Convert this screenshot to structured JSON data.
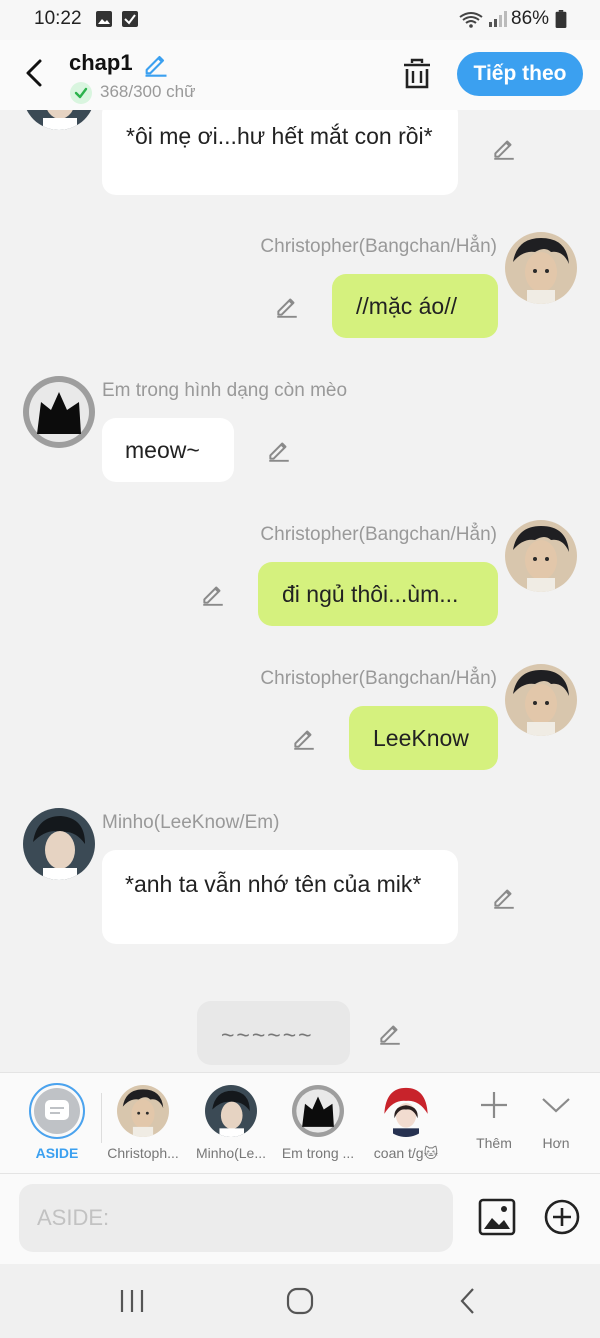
{
  "status_bar": {
    "time": "10:22",
    "battery": "86%"
  },
  "header": {
    "title": "chap1",
    "word_count": "368/300 chữ",
    "next_label": "Tiếp theo"
  },
  "chat": {
    "msg1": {
      "text": "*ôi mẹ ơi...hư hết mắt con rồi*"
    },
    "msg2": {
      "sender": "Christopher(Bangchan/Hẳn)",
      "text": "//mặc áo//"
    },
    "msg3": {
      "sender": "Em trong hình dạng còn mèo",
      "text": "meow~"
    },
    "msg4": {
      "sender": "Christopher(Bangchan/Hẳn)",
      "text": "đi ngủ thôi...ùm..."
    },
    "msg5": {
      "sender": "Christopher(Bangchan/Hẳn)",
      "text": "LeeKnow"
    },
    "msg6": {
      "sender": "Minho(LeeKnow/Em)",
      "text": "*anh ta vẫn nhớ tên của mik*"
    },
    "msg7": {
      "text": "~~~~~~"
    }
  },
  "char_bar": {
    "aside": "ASIDE",
    "items": [
      "Christoph...",
      "Minho(Le...",
      "Em trong ...",
      "coan t/g🐱"
    ],
    "more": "Thêm",
    "less": "Hơn"
  },
  "input": {
    "placeholder": "ASIDE:"
  },
  "colors": {
    "accent": "#3ba0f0",
    "bubble_right": "#d5f17e",
    "bubble_left": "#ffffff"
  }
}
